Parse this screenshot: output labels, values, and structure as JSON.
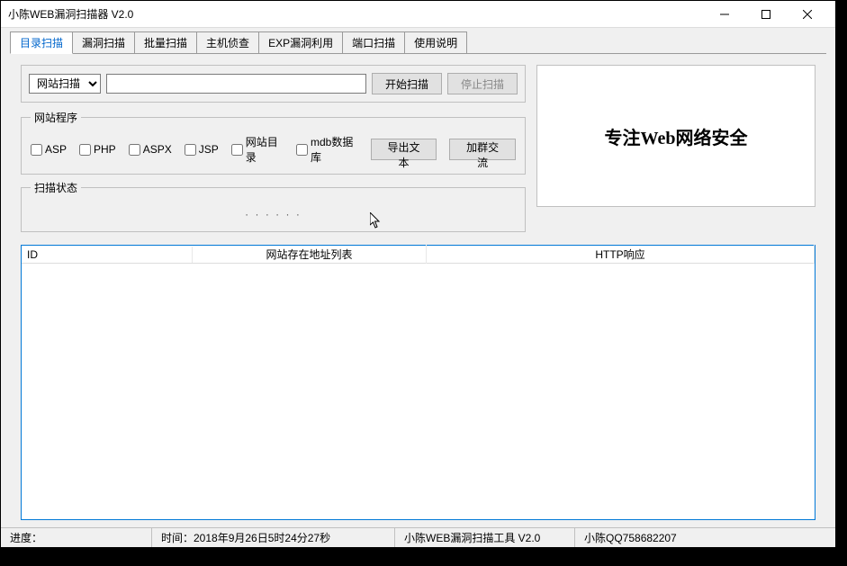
{
  "window": {
    "title": "小陈WEB漏洞扫描器 V2.0"
  },
  "tabs": [
    {
      "label": "目录扫描",
      "active": true
    },
    {
      "label": "漏洞扫描",
      "active": false
    },
    {
      "label": "批量扫描",
      "active": false
    },
    {
      "label": "主机侦查",
      "active": false
    },
    {
      "label": "EXP漏洞利用",
      "active": false
    },
    {
      "label": "端口扫描",
      "active": false
    },
    {
      "label": "使用说明",
      "active": false
    }
  ],
  "scan": {
    "mode_selected": "网站扫描",
    "url_value": "",
    "start_label": "开始扫描",
    "stop_label": "停止扫描"
  },
  "program_group": {
    "legend": "网站程序",
    "checkboxes": [
      {
        "label": "ASP"
      },
      {
        "label": "PHP"
      },
      {
        "label": "ASPX"
      },
      {
        "label": "JSP"
      },
      {
        "label": "网站目录"
      },
      {
        "label": "mdb数据库"
      }
    ],
    "export_label": "导出文本",
    "group_chat_label": "加群交流"
  },
  "status_group": {
    "legend": "扫描状态",
    "content": "· · ·   · · ·"
  },
  "slogan": "专注Web网络安全",
  "table": {
    "columns": [
      "ID",
      "网站存在地址列表",
      "HTTP响应"
    ]
  },
  "statusbar": {
    "progress_label": "进度：",
    "time_label": "时间：2018年9月26日5时24分27秒",
    "product_label": "小陈WEB漏洞扫描工具 V2.0",
    "contact_label": "小陈QQ758682207"
  }
}
